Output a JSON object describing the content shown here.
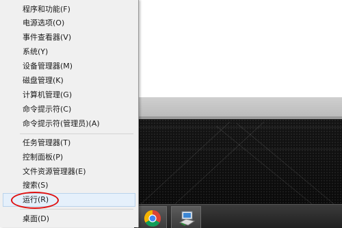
{
  "menu": {
    "items": [
      {
        "label": "程序和功能(F)"
      },
      {
        "label": "电源选项(O)"
      },
      {
        "label": "事件查看器(V)"
      },
      {
        "label": "系统(Y)"
      },
      {
        "label": "设备管理器(M)"
      },
      {
        "label": "磁盘管理(K)"
      },
      {
        "label": "计算机管理(G)"
      },
      {
        "label": "命令提示符(C)"
      },
      {
        "label": "命令提示符(管理员)(A)"
      },
      {
        "label": "任务管理器(T)"
      },
      {
        "label": "控制面板(P)"
      },
      {
        "label": "文件资源管理器(E)"
      },
      {
        "label": "搜索(S)"
      },
      {
        "label": "运行(R)"
      },
      {
        "label": "桌面(D)"
      }
    ],
    "highlighted_item": "运行(R)"
  },
  "taskbar": {
    "icons": [
      "chrome-icon",
      "network-computer-icon"
    ]
  },
  "colors": {
    "menu_background": "#f0f0f0",
    "highlight_fill": "#e5f0fb",
    "highlight_border": "#b9d3ec",
    "annotation_oval": "#e01010"
  }
}
